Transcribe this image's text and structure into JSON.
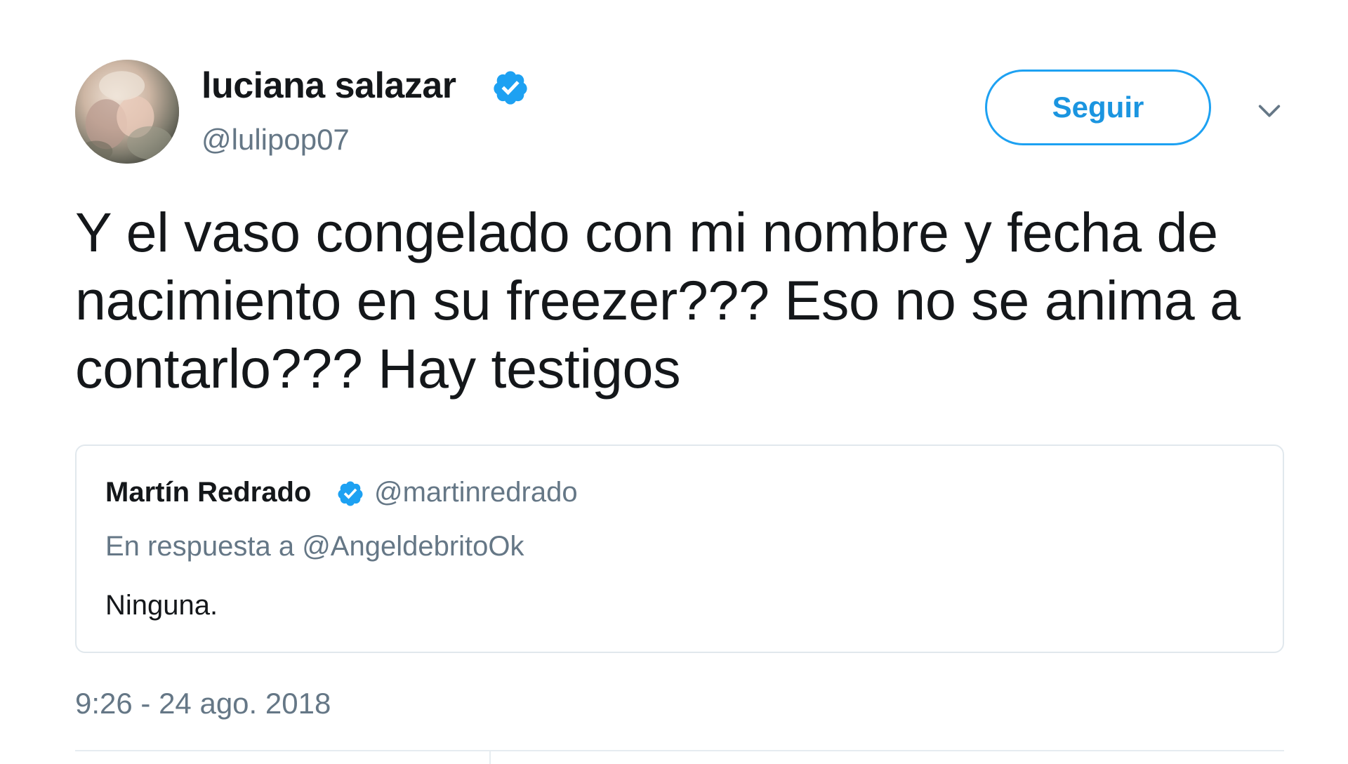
{
  "author": {
    "display_name": "luciana salazar",
    "handle": "@lulipop07",
    "verified": true
  },
  "actions": {
    "follow_label": "Seguir"
  },
  "tweet": {
    "text": "Y el vaso congelado con mi nombre y fecha de nacimiento en su freezer??? Eso no se anima a contarlo??? Hay testigos",
    "timestamp": "9:26 - 24 ago. 2018"
  },
  "quoted_tweet": {
    "display_name": "Martín Redrado",
    "handle": "@martinredrado",
    "verified": true,
    "reply_prefix": "En respuesta a",
    "reply_to": "@AngeldebritoOk",
    "text": "Ninguna."
  },
  "colors": {
    "accent": "#1da1f2",
    "secondary_text": "#657786",
    "primary_text": "#14171a",
    "border": "#e1e8ed"
  },
  "icons": {
    "verified": "verified-badge-icon",
    "caret": "chevron-down-icon"
  }
}
